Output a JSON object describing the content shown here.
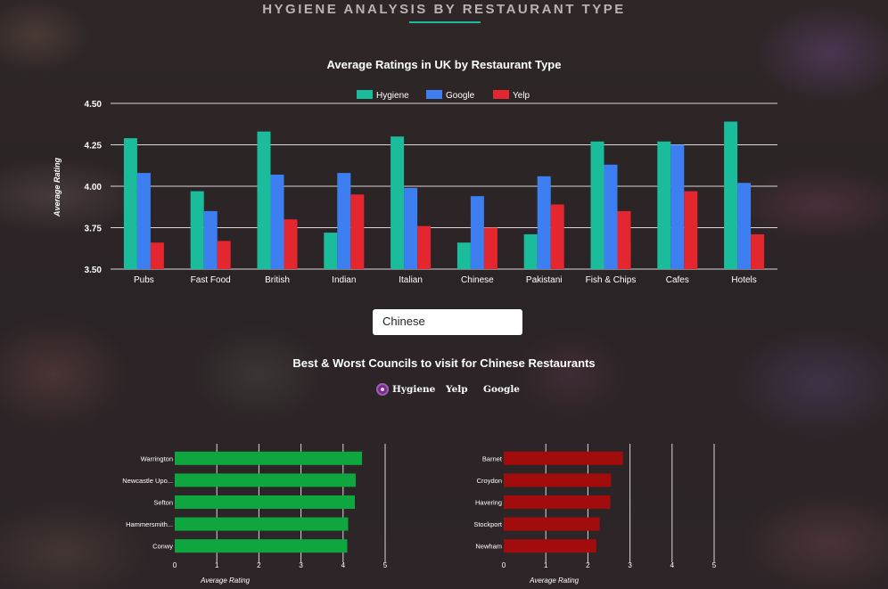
{
  "page": {
    "title": "HYGIENE ANALYSIS BY RESTAURANT TYPE"
  },
  "colors": {
    "hygiene": "#1abc9c",
    "google": "#3d7ff0",
    "yelp": "#e4262f",
    "best": "#0ea63e",
    "worst": "#a30c0c"
  },
  "chart_data": [
    {
      "type": "bar",
      "title": "Average Ratings in UK by Restaurant Type",
      "ylabel": "Average Rating",
      "ylim": [
        3.5,
        4.5
      ],
      "yticks": [
        "3.50",
        "3.75",
        "4.00",
        "4.25",
        "4.50"
      ],
      "legend_position": "top-center",
      "grid": true,
      "categories": [
        "Pubs",
        "Fast Food",
        "British",
        "Indian",
        "Italian",
        "Chinese",
        "Pakistani",
        "Fish & Chips",
        "Cafes",
        "Hotels"
      ],
      "series": [
        {
          "name": "Hygiene",
          "color": "#1abc9c",
          "values": [
            4.29,
            3.97,
            4.33,
            3.72,
            4.3,
            3.66,
            3.71,
            4.27,
            4.27,
            4.39
          ]
        },
        {
          "name": "Google",
          "color": "#3d7ff0",
          "values": [
            4.08,
            3.85,
            4.07,
            4.08,
            3.99,
            3.94,
            4.06,
            4.13,
            4.25,
            4.02
          ]
        },
        {
          "name": "Yelp",
          "color": "#e4262f",
          "values": [
            3.66,
            3.67,
            3.8,
            3.95,
            3.76,
            3.75,
            3.89,
            3.85,
            3.97,
            3.71
          ]
        }
      ]
    },
    {
      "type": "bar",
      "orientation": "horizontal",
      "xlabel": "Average Rating",
      "xlim": [
        0,
        5
      ],
      "xticks": [
        "0",
        "1",
        "2",
        "3",
        "4",
        "5"
      ],
      "color": "#0ea63e",
      "categories": [
        "Warrington",
        "Newcastle Upo...",
        "Sefton",
        "Hammersmith...",
        "Conwy"
      ],
      "values": [
        4.45,
        4.3,
        4.28,
        4.12,
        4.1
      ]
    },
    {
      "type": "bar",
      "orientation": "horizontal",
      "xlabel": "Average Rating",
      "xlim": [
        0,
        5
      ],
      "xticks": [
        "0",
        "1",
        "2",
        "3",
        "4",
        "5"
      ],
      "color": "#a30c0c",
      "categories": [
        "Barnet",
        "Croydon",
        "Havering",
        "Stockport",
        "Newham"
      ],
      "values": [
        2.83,
        2.55,
        2.53,
        2.28,
        2.2
      ]
    }
  ],
  "selector": {
    "value": "Chinese"
  },
  "councils": {
    "title": "Best & Worst Councils to visit for Chinese Restaurants",
    "options": [
      "Hygiene",
      "Yelp",
      "Google"
    ],
    "selected": "Hygiene"
  }
}
